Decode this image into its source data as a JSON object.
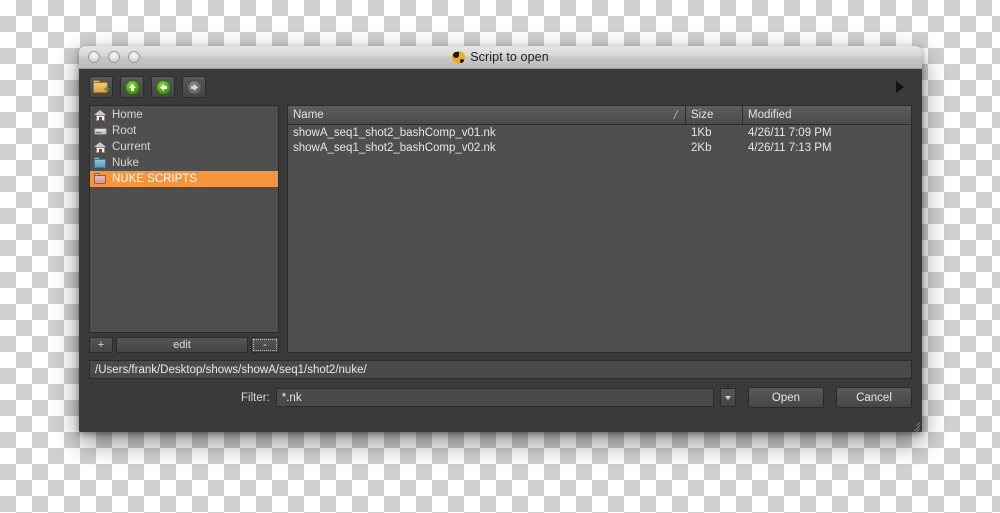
{
  "window": {
    "title": "Script to open",
    "title_icon": "nuke-icon",
    "traffic_lights": [
      "close",
      "minimize",
      "zoom"
    ]
  },
  "toolbar": {
    "buttons": [
      {
        "name": "new-folder-button",
        "icon": "new-folder-icon",
        "enabled": true
      },
      {
        "name": "parent-directory-button",
        "icon": "arrow-up-icon",
        "enabled": true
      },
      {
        "name": "back-button",
        "icon": "arrow-left-icon",
        "enabled": true
      },
      {
        "name": "forward-button",
        "icon": "arrow-right-icon",
        "enabled": false
      }
    ],
    "detail_toggle_icon": "triangle-right-icon"
  },
  "sidebar": {
    "items": [
      {
        "label": "Home",
        "icon": "house-icon",
        "selected": false
      },
      {
        "label": "Root",
        "icon": "hard-drive-icon",
        "selected": false
      },
      {
        "label": "Current",
        "icon": "house-icon",
        "selected": false
      },
      {
        "label": "Nuke",
        "icon": "folder-icon",
        "selected": false
      },
      {
        "label": "NUKE SCRIPTS",
        "icon": "folder-icon",
        "selected": true
      }
    ],
    "add_label": "+",
    "edit_label": "edit",
    "remove_label": "-"
  },
  "filelist": {
    "columns": [
      "Name",
      "Size",
      "Modified"
    ],
    "sort_indicator": "/\\",
    "rows": [
      {
        "name": "showA_seq1_shot2_bashComp_v01.nk",
        "size": "1Kb",
        "modified": "4/26/11 7:09 PM"
      },
      {
        "name": "showA_seq1_shot2_bashComp_v02.nk",
        "size": "2Kb",
        "modified": "4/26/11 7:13 PM"
      }
    ]
  },
  "path": {
    "value": "/Users/frank/Desktop/shows/showA/seq1/shot2/nuke/"
  },
  "filter": {
    "label": "Filter:",
    "value": "*.nk"
  },
  "actions": {
    "open_label": "Open",
    "cancel_label": "Cancel"
  },
  "colors": {
    "accent": "#f5943a",
    "panel": "#4f4f4f",
    "dialog": "#3a3a3a",
    "text": "#e6e6e6"
  }
}
